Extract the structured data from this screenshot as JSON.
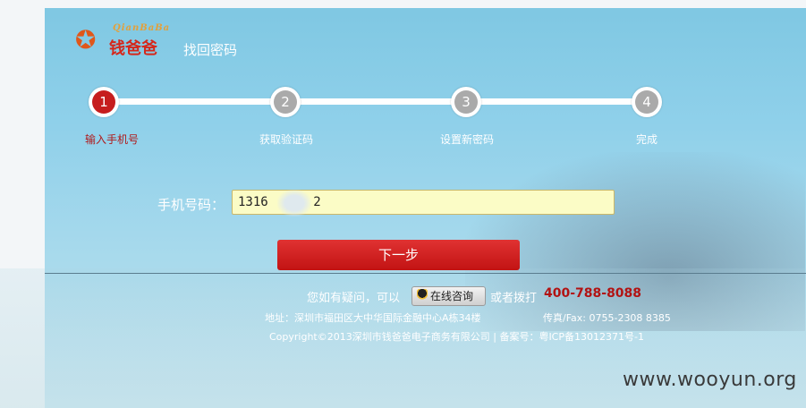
{
  "logo": {
    "mark": "✪",
    "sub_text": "QianBaBa",
    "text": "钱爸爸"
  },
  "page_title": "找回密码",
  "steps": [
    {
      "number": "1",
      "label": "输入手机号",
      "active": true
    },
    {
      "number": "2",
      "label": "获取验证码",
      "active": false
    },
    {
      "number": "3",
      "label": "设置新密码",
      "active": false
    },
    {
      "number": "4",
      "label": "完成",
      "active": false
    }
  ],
  "form": {
    "phone_label": "手机号码：",
    "phone_value": "1316      2",
    "next_label": "下一步"
  },
  "footer": {
    "help_text": "您如有疑问，可以",
    "qq_button": "在线咨询",
    "or_call": "或者拨打",
    "phone": "400-788-8088",
    "address": "地址：深圳市福田区大中华国际金融中心A栋34楼",
    "fax": "传真/Fax: 0755-2308 8385",
    "copyright": "Copyright©2013深圳市钱爸爸电子商务有限公司 | 备案号：粤ICP备13012371号-1"
  },
  "watermark": "www.wooyun.org",
  "colors": {
    "accent": "#c61d1d",
    "inactive_step": "#aaaaaa",
    "input_bg": "#fbfcc6"
  }
}
